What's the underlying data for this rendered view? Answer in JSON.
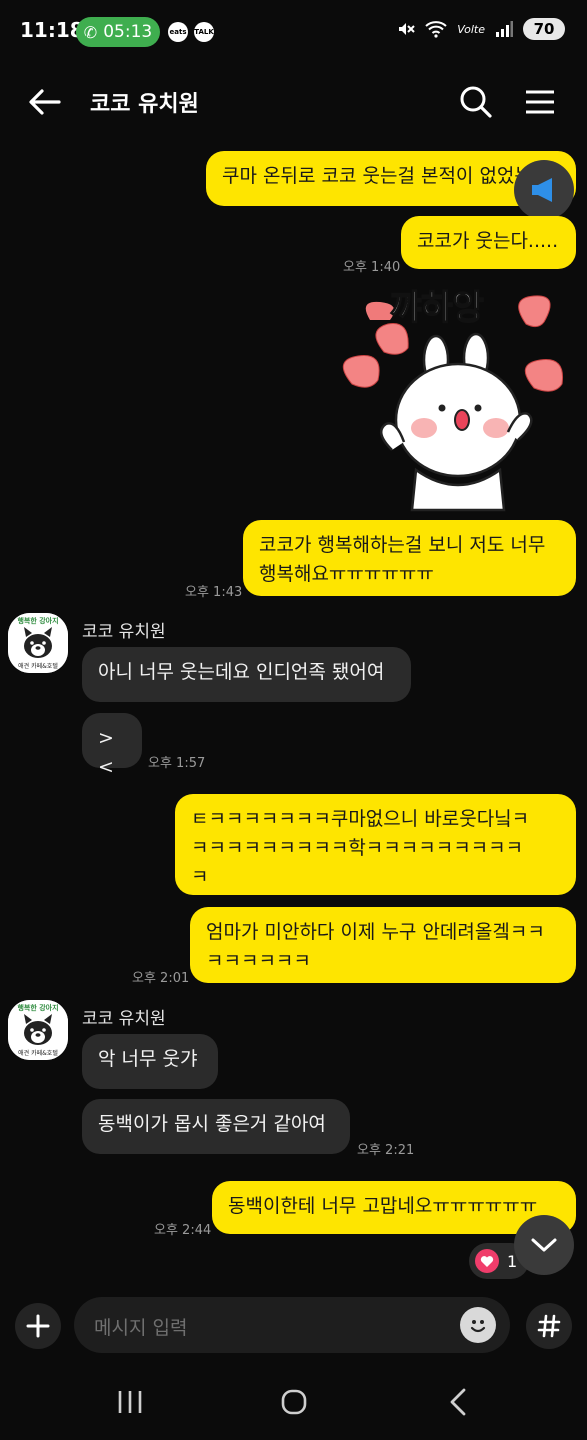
{
  "status_bar": {
    "time": "11:18",
    "call_timer": "05:13",
    "app_icons": [
      "eats",
      "TALK"
    ],
    "network": "Volte",
    "battery": "70"
  },
  "header": {
    "title": "코코 유치원",
    "back_icon": "arrow-left-icon",
    "search_icon": "search-icon",
    "menu_icon": "hamburger-menu-icon"
  },
  "messages": {
    "m1": "쿠마 온뒤로 코코 웃는걸 본적이 없었는데",
    "m2": "코코가 웃는다.....",
    "t2": "오후 1:40",
    "sticker_text": "꺄하앙",
    "m3": "코코가 행복해하는걸 보니 저도 너무\n행복해요ㅠㅠㅠㅠㅠㅠ",
    "t3": "오후 1:43",
    "sender1": "코코 유치원",
    "m4": "아니 너무 웃는데요 인디언족 됐어여",
    "m5": "><",
    "t5": "오후 1:57",
    "m6": "ㅌㅋㅋㅋㅋㅋㅋㅋ쿠마없으니 바로웃다닠ㅋ\nㅋㅋㅋㅋㅋㅋㅋㅋㅋ학ㅋㅋㅋㅋㅋㅋㅋㅋㅋ\nㅋ",
    "m7": "엄마가 미안하다 이제 누구 안데려올겤ㅋㅋ\nㅋㅋㅋㅋㅋㅋ",
    "t7": "오후 2:01",
    "sender2": "코코 유치원",
    "m8": "악 너무 웃갸",
    "m9": "동백이가 몹시 좋은거 같아여",
    "t9": "오후 2:21",
    "m10": "동백이한테 너무 고맙네오ㅠㅠㅠㅠㅠㅠ",
    "t10": "오후 2:44",
    "reaction_count": "1"
  },
  "avatar": {
    "top_text": "행복한 강아지",
    "bottom_text": "애견 카페&호텔"
  },
  "input": {
    "placeholder": "메시지 입력",
    "plus_icon": "plus-icon",
    "emoji_icon": "emoji-icon",
    "hash_icon": "hash-icon"
  },
  "colors": {
    "my_bubble": "#fee500",
    "their_bubble": "#2b2b2b",
    "background": "#0b0b0b",
    "call_green": "#3fae4f"
  }
}
